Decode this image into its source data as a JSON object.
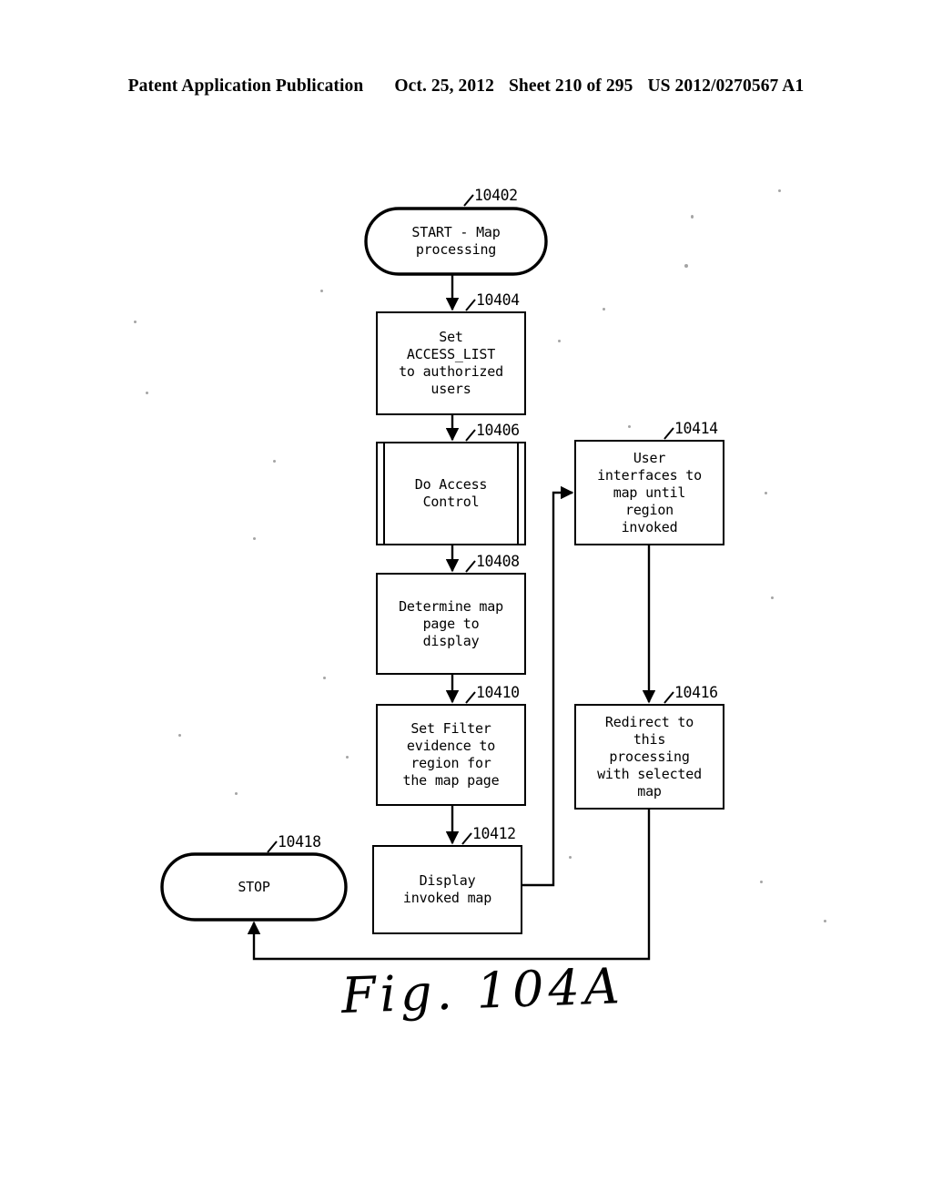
{
  "header": {
    "publication": "Patent Application Publication",
    "date": "Oct. 25, 2012",
    "sheet": "Sheet 210 of 295",
    "docket": "US 2012/0270567 A1"
  },
  "figure": {
    "caption": "Fig. 104A",
    "ink_color": "#000000",
    "paper_color": "#ffffff"
  },
  "nodes": {
    "start": {
      "ref": "10402",
      "label": "START - Map\nprocessing",
      "shape": "stadium"
    },
    "set_access_list": {
      "ref": "10404",
      "label": "Set\nACCESS_LIST\nto authorized\nusers",
      "shape": "process"
    },
    "do_access_control": {
      "ref": "10406",
      "label": "Do Access\nControl",
      "shape": "predefined-process"
    },
    "determine_map_page": {
      "ref": "10408",
      "label": "Determine map\npage to\ndisplay",
      "shape": "process"
    },
    "set_filter": {
      "ref": "10410",
      "label": "Set Filter\nevidence to\nregion for\nthe map page",
      "shape": "process"
    },
    "display_map": {
      "ref": "10412",
      "label": "Display\ninvoked map",
      "shape": "process"
    },
    "user_interfaces": {
      "ref": "10414",
      "label": "User\ninterfaces to\nmap until\nregion\ninvoked",
      "shape": "process"
    },
    "redirect": {
      "ref": "10416",
      "label": "Redirect to\nthis\nprocessing\nwith selected\nmap",
      "shape": "process"
    },
    "stop": {
      "ref": "10418",
      "label": "STOP",
      "shape": "stadium"
    }
  },
  "edges": [
    {
      "from": "start",
      "to": "set_access_list"
    },
    {
      "from": "set_access_list",
      "to": "do_access_control"
    },
    {
      "from": "do_access_control",
      "to": "determine_map_page"
    },
    {
      "from": "determine_map_page",
      "to": "set_filter"
    },
    {
      "from": "set_filter",
      "to": "display_map"
    },
    {
      "from": "display_map",
      "to": "user_interfaces"
    },
    {
      "from": "user_interfaces",
      "to": "redirect"
    },
    {
      "from": "redirect",
      "to": "stop"
    }
  ]
}
